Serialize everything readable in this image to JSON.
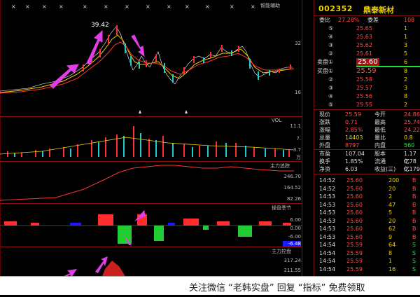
{
  "chart": {
    "panels": [
      {
        "title": "智能辅助",
        "axis": [
          "32",
          "16"
        ]
      },
      {
        "title": "VOL",
        "axis": [
          "11.1",
          "7.",
          "3.7"
        ],
        "unit": "万"
      },
      {
        "title": "主力追踪",
        "axis": [
          "246.70",
          "164.52",
          "82.26"
        ]
      },
      {
        "title": "操盘季节",
        "axis": [
          "6.00",
          "0.00",
          "-6.00",
          "-6.48"
        ]
      },
      {
        "title": "主力控盘",
        "axis": [
          "317.24",
          "211.55"
        ]
      }
    ],
    "price_label": "39.42"
  },
  "right": {
    "code": "002352",
    "name": "鼎泰新材",
    "weibi": {
      "label": "委比",
      "value": "27.28%",
      "label2": "委差",
      "value2": "108"
    },
    "sell": [
      {
        "idx": "⑤",
        "price": "25.65",
        "vol": "1"
      },
      {
        "idx": "④",
        "price": "25.63",
        "vol": "1"
      },
      {
        "idx": "③",
        "price": "25.62",
        "vol": "3"
      },
      {
        "idx": "②",
        "price": "25.61",
        "vol": "5"
      },
      {
        "idx": "①",
        "price": "25.60",
        "vol": "6"
      }
    ],
    "sell_label": "卖盘",
    "buy_label": "买盘",
    "buy": [
      {
        "idx": "①",
        "price": "25.59",
        "vol": "8"
      },
      {
        "idx": "②",
        "price": "25.58",
        "vol": "2"
      },
      {
        "idx": "③",
        "price": "25.57",
        "vol": "3"
      },
      {
        "idx": "④",
        "price": "25.56",
        "vol": "8"
      },
      {
        "idx": "⑤",
        "price": "25.55",
        "vol": "2"
      }
    ],
    "stats": [
      {
        "l": "现价",
        "v": "25.59",
        "l2": "今开",
        "v2": "24.86"
      },
      {
        "l": "涨跌",
        "v": "0.71",
        "l2": "最高",
        "v2": "25.74"
      },
      {
        "l": "涨幅",
        "v": "2.85%",
        "l2": "最低",
        "v2": "24.22"
      },
      {
        "l": "总量",
        "v": "14403",
        "l2": "量比",
        "v2": "0.8"
      },
      {
        "l": "外盘",
        "v": "8797",
        "l2": "内盘",
        "v2": "560"
      },
      {
        "l": "市盈",
        "v": "107.04",
        "l2": "股本",
        "v2": "1.17亿"
      },
      {
        "l": "换手",
        "v": "1.85%",
        "l2": "流通",
        "v2": "0.78亿"
      },
      {
        "l": "净资",
        "v": "6.03",
        "l2": "收益(三)",
        "v2": "0.179"
      }
    ],
    "ticks": [
      {
        "t": "14:52",
        "p": "25.60",
        "v": "200",
        "s": "B"
      },
      {
        "t": "14:52",
        "p": "25.60",
        "v": "20",
        "s": "B"
      },
      {
        "t": "14:53",
        "p": "25.60",
        "v": "2",
        "s": "B"
      },
      {
        "t": "14:53",
        "p": "25.60",
        "v": "47",
        "s": "B"
      },
      {
        "t": "14:53",
        "p": "25.60",
        "v": "5",
        "s": "B"
      },
      {
        "t": "14:53",
        "p": "25.60",
        "v": "20",
        "s": "B"
      },
      {
        "t": "14:53",
        "p": "25.60",
        "v": "62",
        "s": "B"
      },
      {
        "t": "14:53",
        "p": "25.60",
        "v": "9",
        "s": "B"
      },
      {
        "t": "14:54",
        "p": "25.59",
        "v": "64",
        "s": "S"
      },
      {
        "t": "14:54",
        "p": "25.59",
        "v": "8",
        "s": "S"
      },
      {
        "t": "14:54",
        "p": "25.59",
        "v": "1",
        "s": "S"
      },
      {
        "t": "14:54",
        "p": "25.59",
        "v": "16",
        "s": "S"
      }
    ]
  },
  "watermark": "关注微信 “老韩实盘” 回复 “指标” 免费领取"
}
